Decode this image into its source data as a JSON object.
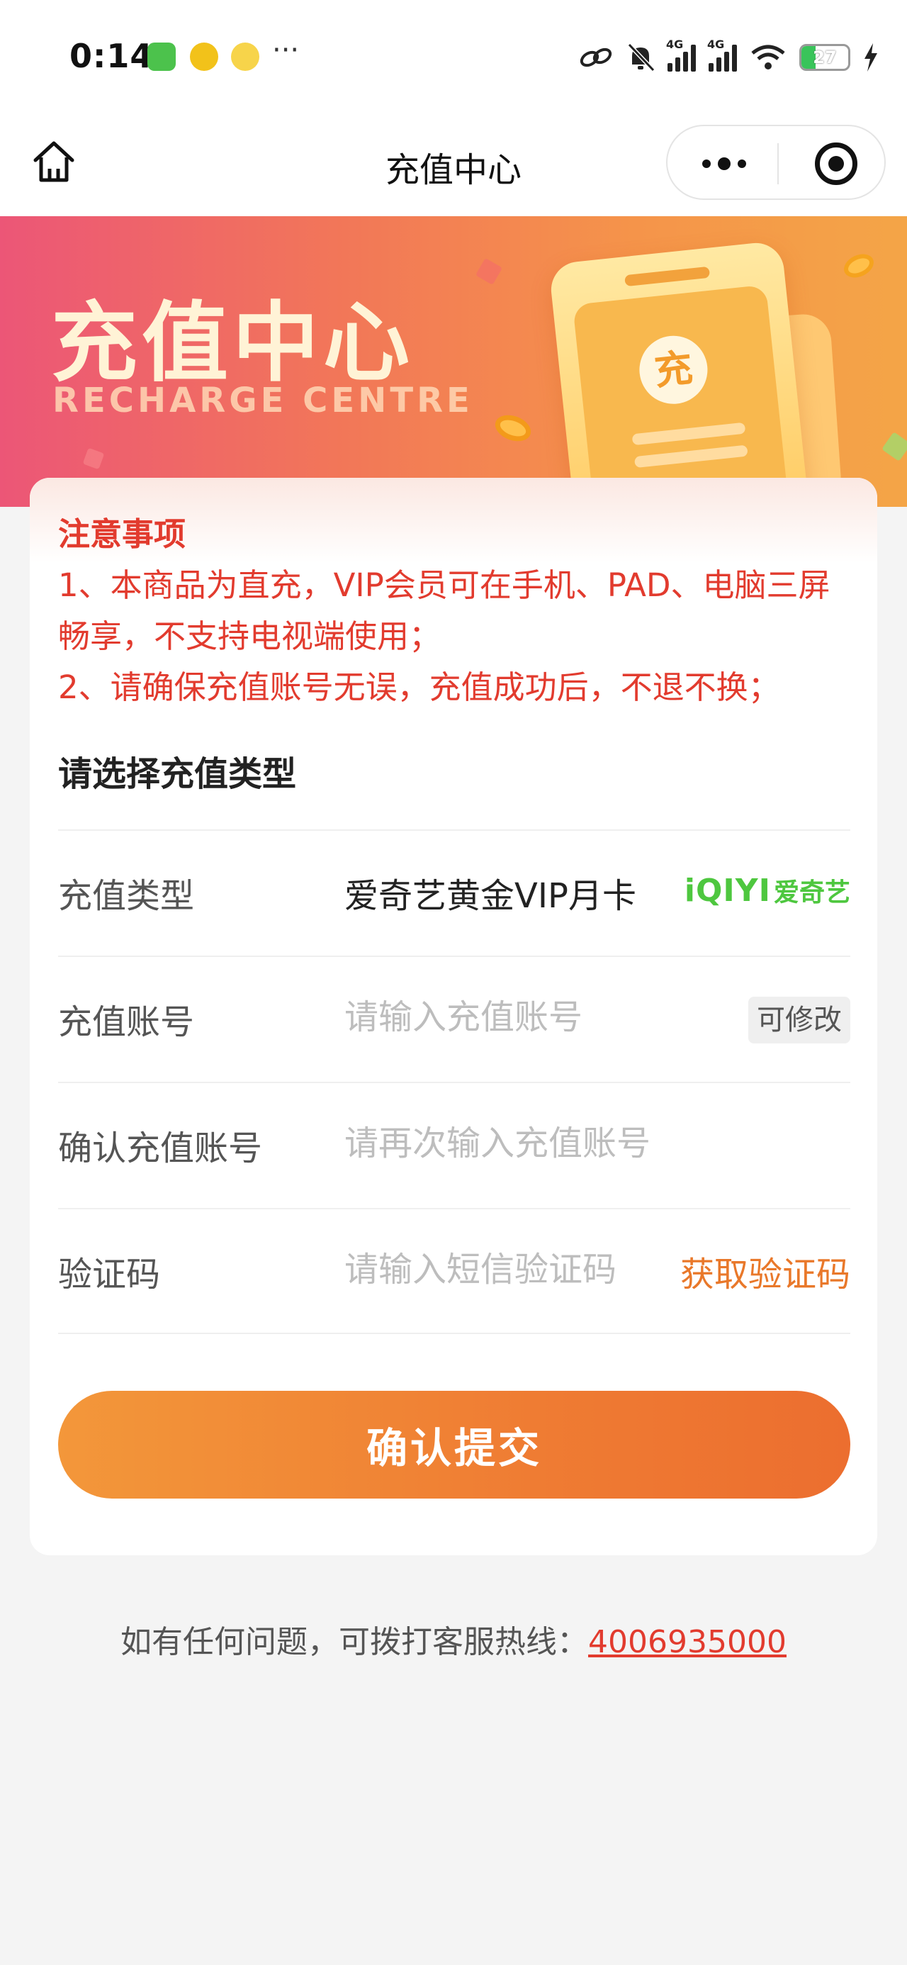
{
  "status_bar": {
    "time": "0:14",
    "network_left": "4G",
    "network_right": "4G",
    "battery": "27",
    "more": "···"
  },
  "nav": {
    "title": "充值中心"
  },
  "banner": {
    "title": "充值中心",
    "subtitle": "RECHARGE CENTRE",
    "coin_text": "充"
  },
  "notice": {
    "title": "注意事项",
    "line1": "1、本商品为直充，VIP会员可在手机、PAD、电脑三屏畅享，不支持电视端使用；",
    "line2": "2、请确保充值账号无误，充值成功后，不退不换；"
  },
  "form": {
    "section_title": "请选择充值类型",
    "type_label": "充值类型",
    "type_value": "爱奇艺黄金VIP月卡",
    "brand_en": "iQIYI",
    "brand_zh": "爱奇艺",
    "account_label": "充值账号",
    "account_placeholder": "请输入充值账号",
    "account_tag": "可修改",
    "confirm_label": "确认充值账号",
    "confirm_placeholder": "请再次输入充值账号",
    "code_label": "验证码",
    "code_placeholder": "请输入短信验证码",
    "get_code": "获取验证码",
    "submit": "确认提交"
  },
  "footer": {
    "text": "如有任何问题，可拨打客服热线：",
    "hotline": "4006935000"
  },
  "colors": {
    "accent_orange": "#ef7c33",
    "notice_red": "#e23b2e",
    "brand_green": "#4ec73f"
  }
}
